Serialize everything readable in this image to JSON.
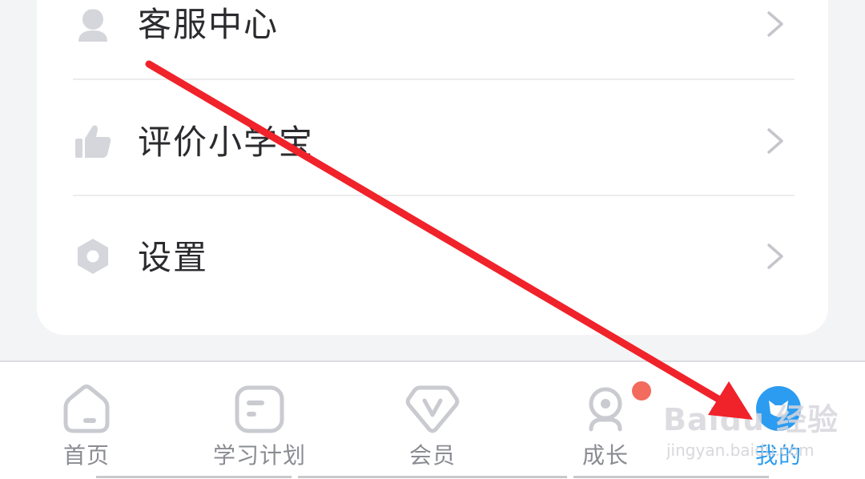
{
  "menu": {
    "items": [
      {
        "label": "客服中心",
        "icon": "headset-icon"
      },
      {
        "label": "评价小学宝",
        "icon": "thumbs-up-icon"
      },
      {
        "label": "设置",
        "icon": "settings-icon"
      }
    ]
  },
  "tabbar": {
    "tabs": [
      {
        "label": "首页",
        "icon": "home-icon",
        "active": false
      },
      {
        "label": "学习计划",
        "icon": "study-plan-icon",
        "active": false
      },
      {
        "label": "会员",
        "icon": "vip-icon",
        "active": false
      },
      {
        "label": "成长",
        "icon": "growth-icon",
        "active": false,
        "badge": true
      },
      {
        "label": "我的",
        "icon": "profile-icon",
        "active": true
      }
    ]
  },
  "watermark": {
    "logo": "Baidu 经验",
    "url": "jingyan.baidu.com"
  },
  "colors": {
    "accent": "#2c9cf0",
    "badge": "#f26b5d",
    "annotation_arrow": "#f0222a",
    "icon_gray": "#d4d6db"
  }
}
